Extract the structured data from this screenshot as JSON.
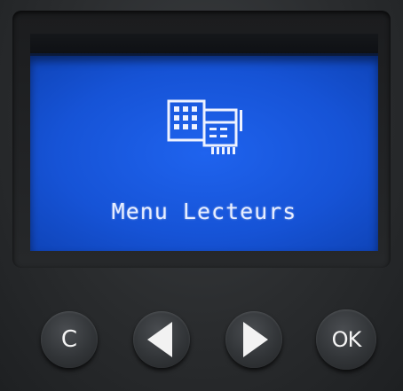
{
  "screen": {
    "menu_title": "Menu Lecteurs",
    "icon": "card-reader-icon",
    "background_color": "#1a5ae0",
    "text_color": "#e8eeff"
  },
  "buttons": {
    "cancel_label": "C",
    "left_icon": "left-arrow-icon",
    "right_icon": "right-arrow-icon",
    "ok_label": "OK"
  }
}
